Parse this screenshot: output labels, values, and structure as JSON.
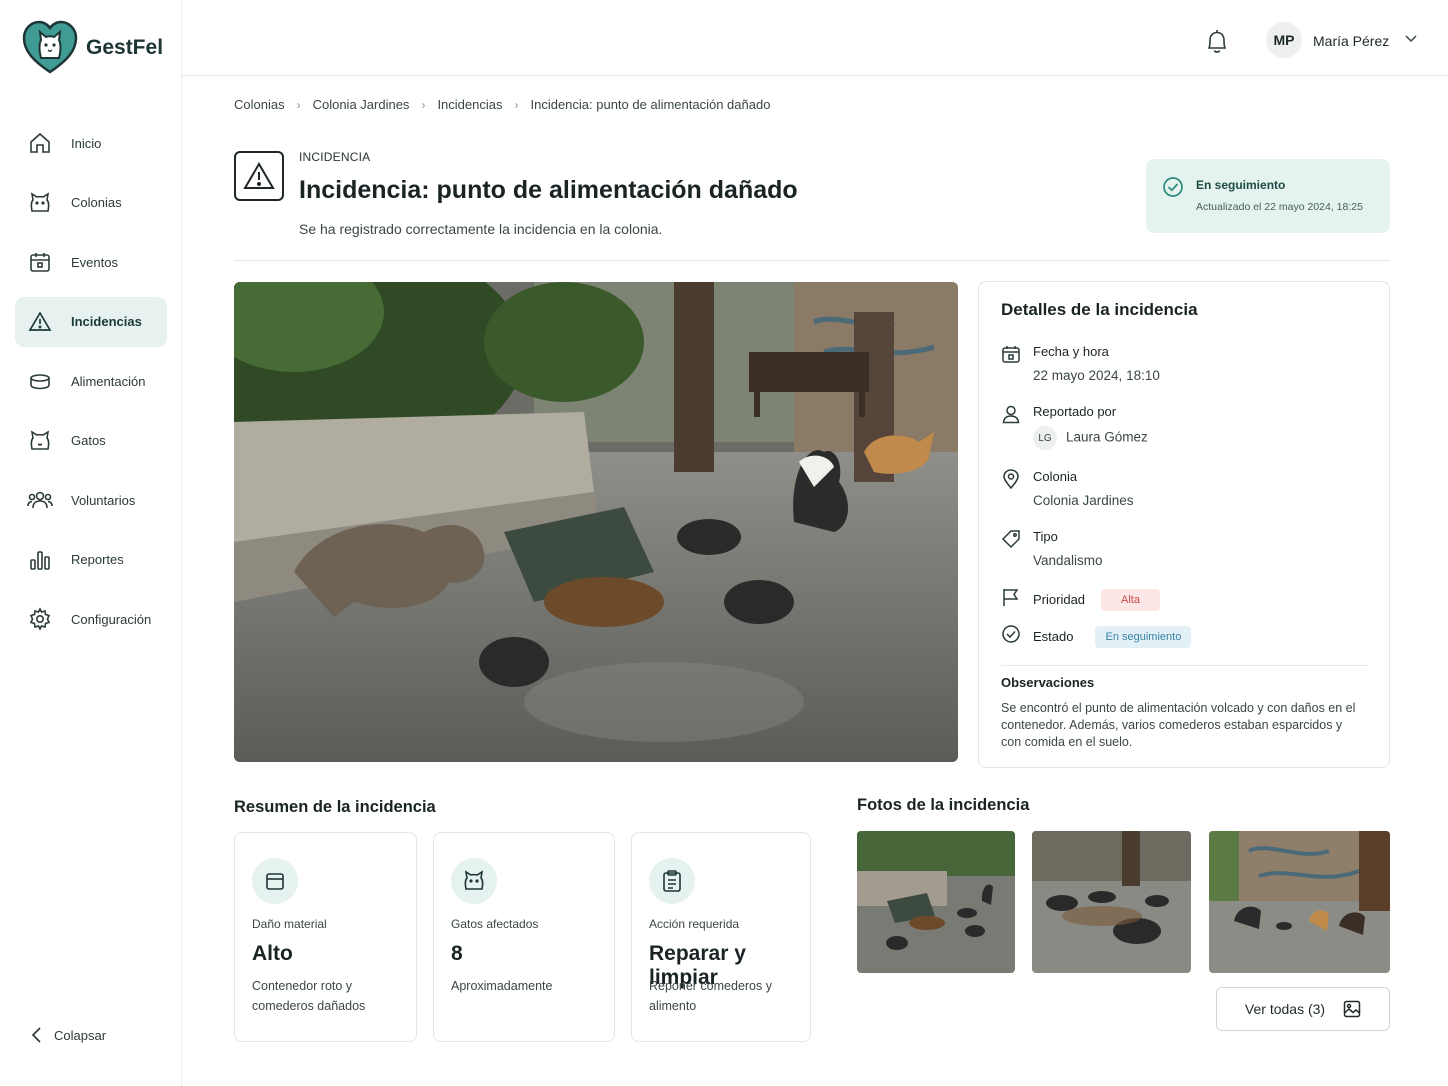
{
  "brand": {
    "name": "GestFel"
  },
  "sidebar": {
    "items": [
      {
        "label": "Inicio",
        "icon": "home-icon"
      },
      {
        "label": "Colonias",
        "icon": "cat-face-icon"
      },
      {
        "label": "Eventos",
        "icon": "calendar-icon"
      },
      {
        "label": "Incidencias",
        "icon": "warning-icon",
        "active": true
      },
      {
        "label": "Alimentación",
        "icon": "bowl-icon"
      },
      {
        "label": "Gatos",
        "icon": "cat-icon"
      },
      {
        "label": "Voluntarios",
        "icon": "people-icon"
      },
      {
        "label": "Reportes",
        "icon": "bar-chart-icon"
      },
      {
        "label": "Configuración",
        "icon": "gear-icon"
      }
    ],
    "collapse_label": "Colapsar"
  },
  "header": {
    "user_initials": "MP",
    "user_name": "María Pérez"
  },
  "breadcrumb": [
    "Colonias",
    "Colonia Jardines",
    "Incidencias",
    "Incidencia: punto de alimentación dañado"
  ],
  "page": {
    "kicker": "INCIDENCIA",
    "title": "Incidencia: punto de alimentación dañado",
    "subtitle": "Se ha registrado correctamente la incidencia en la colonia."
  },
  "status_card": {
    "title": "En seguimiento",
    "updated": "Actualizado el 22 mayo 2024, 18:25"
  },
  "details": {
    "title": "Detalles de la incidencia",
    "fecha_label": "Fecha y hora",
    "fecha_value": "22 mayo 2024, 18:10",
    "reportado_label": "Reportado por",
    "reportado_initials": "LG",
    "reportado_value": "Laura Gómez",
    "colonia_label": "Colonia",
    "colonia_value": "Colonia Jardines",
    "tipo_label": "Tipo",
    "tipo_value": "Vandalismo",
    "prioridad_label": "Prioridad",
    "prioridad_value": "Alta",
    "estado_label": "Estado",
    "estado_value": "En seguimiento",
    "obs_label": "Observaciones",
    "obs_text": "Se encontró el punto de alimentación volcado y con daños en el contenedor. Además, varios comederos estaban esparcidos y con comida en el suelo."
  },
  "summary": {
    "title": "Resumen de la incidencia",
    "cards": [
      {
        "label": "Daño material",
        "value": "Alto",
        "desc": "Contenedor roto y comederos dañados"
      },
      {
        "label": "Gatos afectados",
        "value": "8",
        "desc": "Aproximadamente"
      },
      {
        "label": "Acción requerida",
        "value": "Reparar y limpiar",
        "desc": "Reponer comederos y alimento"
      }
    ]
  },
  "photos": {
    "title": "Fotos de la incidencia",
    "view_all": "Ver todas (3)"
  },
  "colors": {
    "accent": "#1d7a72",
    "active_bg": "#e7f2f0",
    "status_bg": "#e5f3ef",
    "alta_bg": "#fde6e6",
    "seg_bg": "#e3f0f6"
  }
}
